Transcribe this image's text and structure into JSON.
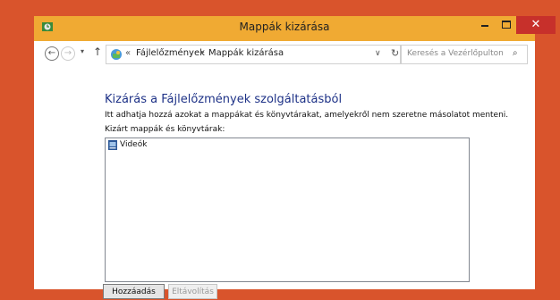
{
  "window": {
    "title": "Mappák kizárása",
    "close_symbol": "✕"
  },
  "nav": {
    "back_symbol": "←",
    "forward_symbol": "→",
    "recent_symbol": "▾",
    "up_symbol": "↑",
    "chevron": "«",
    "breadcrumb": [
      "Fájlelőzmények",
      "Mappák kizárása"
    ],
    "separator": "▸",
    "dropdown_symbol": "∨",
    "refresh_symbol": "↻",
    "search_placeholder": "Keresés a Vezérlőpulton",
    "search_symbol": "⌕"
  },
  "main": {
    "heading": "Kizárás a Fájlelőzmények szolgáltatásból",
    "description": "Itt adhatja hozzá azokat a mappákat és könyvtárakat, amelyekről nem szeretne másolatot menteni.",
    "list_label": "Kizárt mappák és könyvtárak:",
    "items": [
      {
        "label": "Videók",
        "icon": "video-library-icon"
      }
    ],
    "add_button": "Hozzáadás",
    "remove_button": "Eltávolítás"
  },
  "colors": {
    "desktop": "#d9542c",
    "window_frame": "#f0aa33",
    "close": "#c7302b",
    "heading": "#1e3287"
  }
}
